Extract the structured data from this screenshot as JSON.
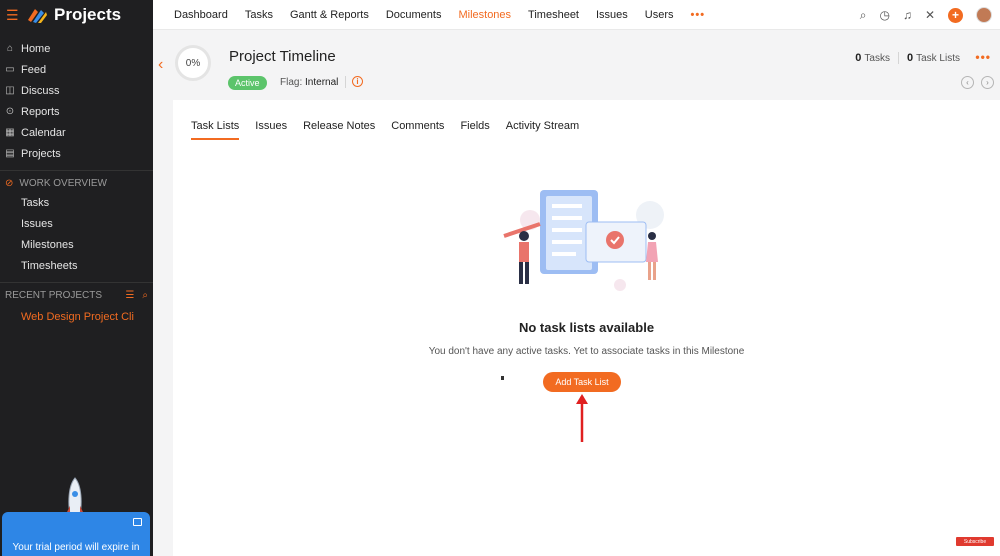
{
  "app": {
    "title": "Projects"
  },
  "sidebar": {
    "items": [
      {
        "label": "Home",
        "icon": "home-icon"
      },
      {
        "label": "Feed",
        "icon": "feed-icon"
      },
      {
        "label": "Discuss",
        "icon": "discuss-icon"
      },
      {
        "label": "Reports",
        "icon": "reports-icon"
      },
      {
        "label": "Calendar",
        "icon": "calendar-icon"
      },
      {
        "label": "Projects",
        "icon": "projects-icon"
      }
    ],
    "work_overview": {
      "heading": "WORK OVERVIEW",
      "items": [
        "Tasks",
        "Issues",
        "Milestones",
        "Timesheets"
      ]
    },
    "recent_projects": {
      "heading": "RECENT PROJECTS",
      "items": [
        "Web Design Project Cli"
      ]
    },
    "trial_text": "Your trial period will expire in"
  },
  "topnav": {
    "items": [
      "Dashboard",
      "Tasks",
      "Gantt & Reports",
      "Documents",
      "Milestones",
      "Timesheet",
      "Issues",
      "Users"
    ],
    "active": "Milestones",
    "more": "•••"
  },
  "milestone": {
    "progress": "0%",
    "title": "Project Timeline",
    "status": "Active",
    "flag_label": "Flag:",
    "flag_value": "Internal",
    "tasks_count": "0",
    "tasks_label": "Tasks",
    "tasklists_count": "0",
    "tasklists_label": "Task Lists",
    "more": "•••"
  },
  "tabs": [
    "Task Lists",
    "Issues",
    "Release Notes",
    "Comments",
    "Fields",
    "Activity Stream"
  ],
  "empty_state": {
    "title": "No task lists available",
    "description": "You don't have any active tasks. Yet to associate tasks in this Milestone",
    "button": "Add Task List"
  },
  "subscribe_label": "Subscribe",
  "colors": {
    "accent": "#f26b21",
    "sidebar": "#1f1f21",
    "active_badge": "#5cc46b",
    "trial": "#2e86e6"
  }
}
